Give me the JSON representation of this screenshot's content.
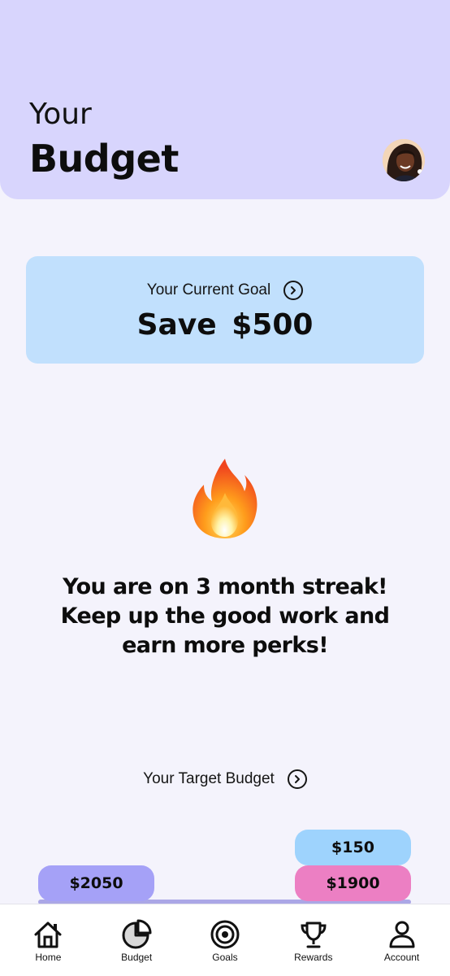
{
  "header": {
    "line1": "Your",
    "line2": "Budget"
  },
  "goal": {
    "label": "Your Current Goal",
    "value": "Save  $500"
  },
  "streak": {
    "text": "You are on 3 month streak! Keep up the good work and earn more perks!"
  },
  "target": {
    "label": "Your Target Budget",
    "pills": {
      "left": "$2050",
      "right_top": "$150",
      "right_bottom": "$1900"
    }
  },
  "nav": {
    "items": [
      {
        "label": "Home",
        "icon": "home-icon"
      },
      {
        "label": "Budget",
        "icon": "pie-chart-icon"
      },
      {
        "label": "Goals",
        "icon": "target-icon"
      },
      {
        "label": "Rewards",
        "icon": "trophy-icon"
      },
      {
        "label": "Account",
        "icon": "person-icon"
      }
    ]
  },
  "colors": {
    "header_bg": "#d8d5fd",
    "goal_card_bg": "#c1e0fd",
    "page_bg": "#f4f3fc",
    "pill_purple": "#a5a1f7",
    "pill_blue": "#9ed3fd",
    "pill_pink": "#ec7fc3"
  }
}
